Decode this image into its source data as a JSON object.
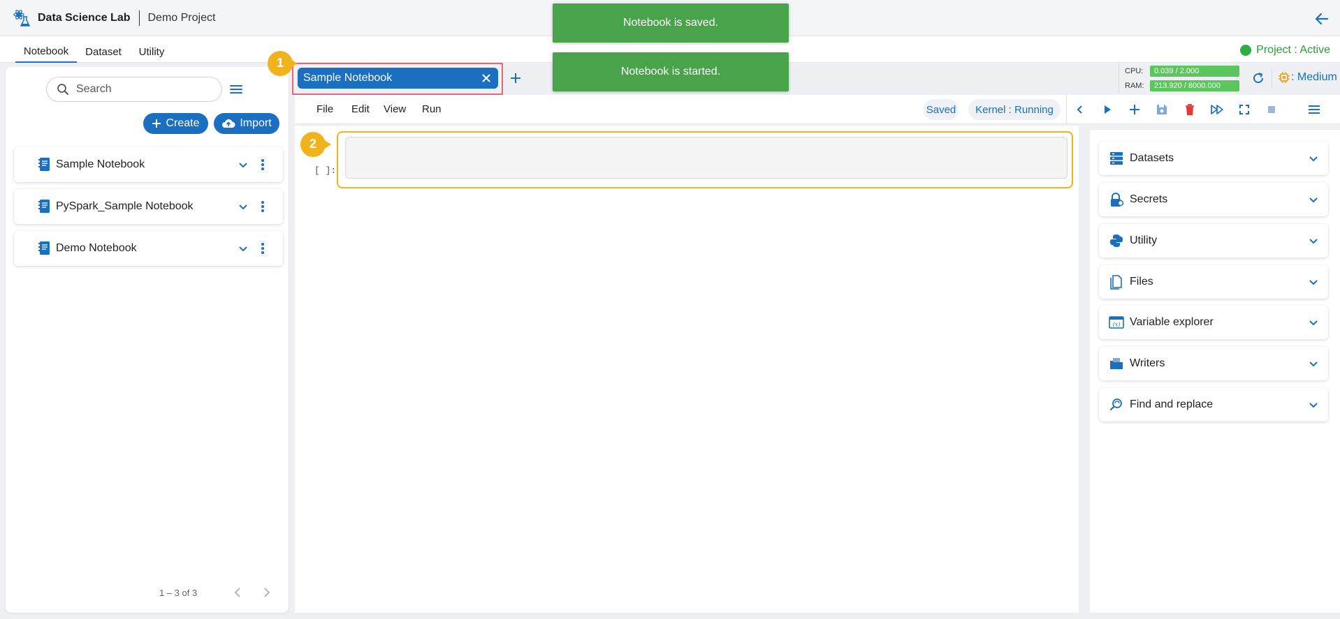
{
  "header": {
    "app_title": "Data Science Lab",
    "project_name": "Demo Project"
  },
  "nav": {
    "tabs": [
      "Notebook",
      "Dataset",
      "Utility"
    ],
    "active_tab": "Notebook",
    "project_status": "Project : Active"
  },
  "sidebar": {
    "search_placeholder": "Search",
    "create_label": "Create",
    "import_label": "Import",
    "notebooks": [
      "Sample Notebook",
      "PySpark_Sample Notebook",
      "Demo Notebook"
    ],
    "pagination": "1 – 3 of 3"
  },
  "tab": {
    "name": "Sample Notebook"
  },
  "callouts": {
    "first": "1",
    "second": "2"
  },
  "resources": {
    "cpu_label": "CPU:",
    "cpu_value": "0.039 / 2.000",
    "ram_label": "RAM:",
    "ram_value": "213.920 / 8000.000",
    "size": ": Medium"
  },
  "menu": {
    "items": [
      "File",
      "Edit",
      "View",
      "Run"
    ],
    "saved_chip": "Saved",
    "kernel_chip": "Kernel : Running"
  },
  "cell": {
    "prompt": "[  ]:"
  },
  "right_panel": {
    "sections": [
      "Datasets",
      "Secrets",
      "Utility",
      "Files",
      "Variable explorer",
      "Writers",
      "Find and replace"
    ]
  },
  "toasts": {
    "saved": "Notebook is saved.",
    "started": "Notebook is started."
  },
  "colors": {
    "primary": "#1a6fc0",
    "success": "#49a34b",
    "status_active": "#2fae45",
    "callout": "#f2b21c",
    "tab_highlight": "#e06a7a",
    "delete": "#e53935"
  }
}
